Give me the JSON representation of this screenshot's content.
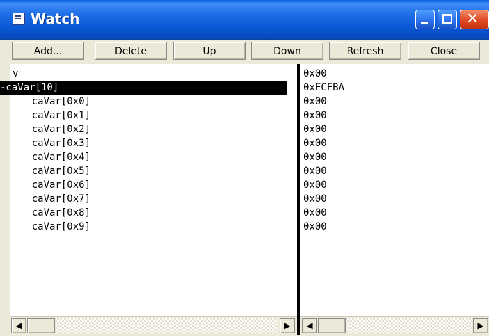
{
  "window": {
    "title": "Watch",
    "icon": "watch-window-icon"
  },
  "toolbar": {
    "add_label": "Add...",
    "delete_label": "Delete",
    "up_label": "Up",
    "down_label": "Down",
    "refresh_label": "Refresh",
    "close_label": "Close"
  },
  "watch": {
    "names": [
      "v",
      "-caVar[10]",
      "    caVar[0x0]",
      "    caVar[0x1]",
      "    caVar[0x2]",
      "    caVar[0x3]",
      "    caVar[0x4]",
      "    caVar[0x5]",
      "    caVar[0x6]",
      "    caVar[0x7]",
      "    caVar[0x8]",
      "    caVar[0x9]"
    ],
    "values": [
      "0x00",
      "0xFCFBA",
      "0x00",
      "0x00",
      "0x00",
      "0x00",
      "0x00",
      "0x00",
      "0x00",
      "0x00",
      "0x00",
      "0x00"
    ],
    "selected_index": 1
  },
  "colors": {
    "titlebar": "#0a58d6",
    "selection_bg": "#000000",
    "selection_fg": "#ffffff",
    "face": "#ece9d8"
  }
}
